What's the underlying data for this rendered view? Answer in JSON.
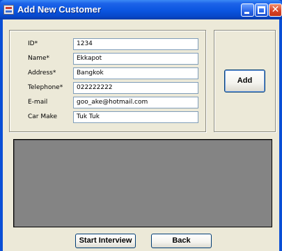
{
  "window": {
    "title": "Add New Customer"
  },
  "form": {
    "fields": [
      {
        "label": "ID*",
        "value": "1234"
      },
      {
        "label": "Name*",
        "value": "Ekkapot"
      },
      {
        "label": "Address*",
        "value": "Bangkok"
      },
      {
        "label": "Telephone*",
        "value": "022222222"
      },
      {
        "label": "E-mail",
        "value": "goo_ake@hotmail.com"
      },
      {
        "label": "Car Make",
        "value": "Tuk Tuk"
      }
    ]
  },
  "buttons": {
    "add": "Add",
    "start_interview": "Start Interview",
    "back": "Back"
  },
  "colors": {
    "titlebar": "#0a55e0",
    "form_background": "#ece9d8",
    "display_panel": "#848484"
  },
  "icons": {
    "app": "app-form-icon",
    "minimize": "minimize-icon",
    "maximize": "maximize-icon",
    "close": "close-icon"
  }
}
